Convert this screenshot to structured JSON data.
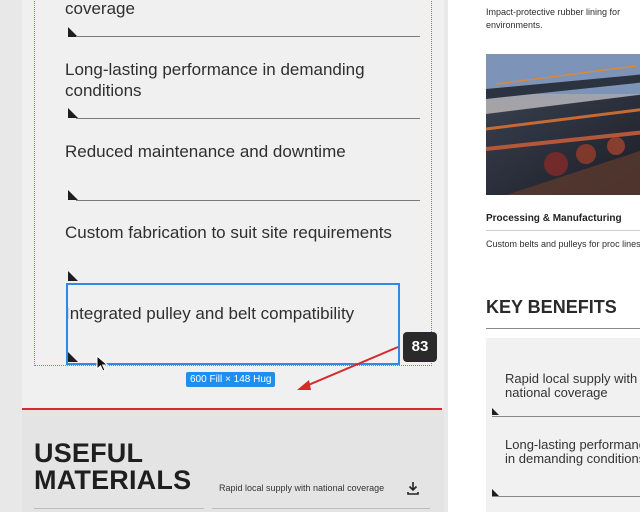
{
  "benefits": [
    "coverage",
    "Long-lasting performance in demanding conditions",
    "Reduced maintenance and downtime",
    "Custom fabrication to suit site requirements",
    "Integrated pulley and belt compatibility"
  ],
  "selection": {
    "size_label": "600 Fill × 148 Hug",
    "spacing_value": "83"
  },
  "materials": {
    "title": "USEFUL MATERIALS",
    "document_name": "Rapid local supply with national coverage"
  },
  "preview": {
    "intro_text": "Impact-protective rubber lining for environments.",
    "section_heading": "Processing & Manufacturing",
    "section_text": "Custom belts and pulleys for proc lines.",
    "key_benefits_title": "KEY BENEFITS",
    "benefits": [
      "Rapid local supply with national coverage",
      "Long-lasting performance in demanding conditions"
    ]
  },
  "colors": {
    "selection_blue": "#2e8ae6",
    "divider_red": "#d62a2a",
    "badge_dark": "#2a2a2a"
  },
  "icons": {
    "download": "download-icon",
    "cursor": "pointer-cursor-icon"
  }
}
